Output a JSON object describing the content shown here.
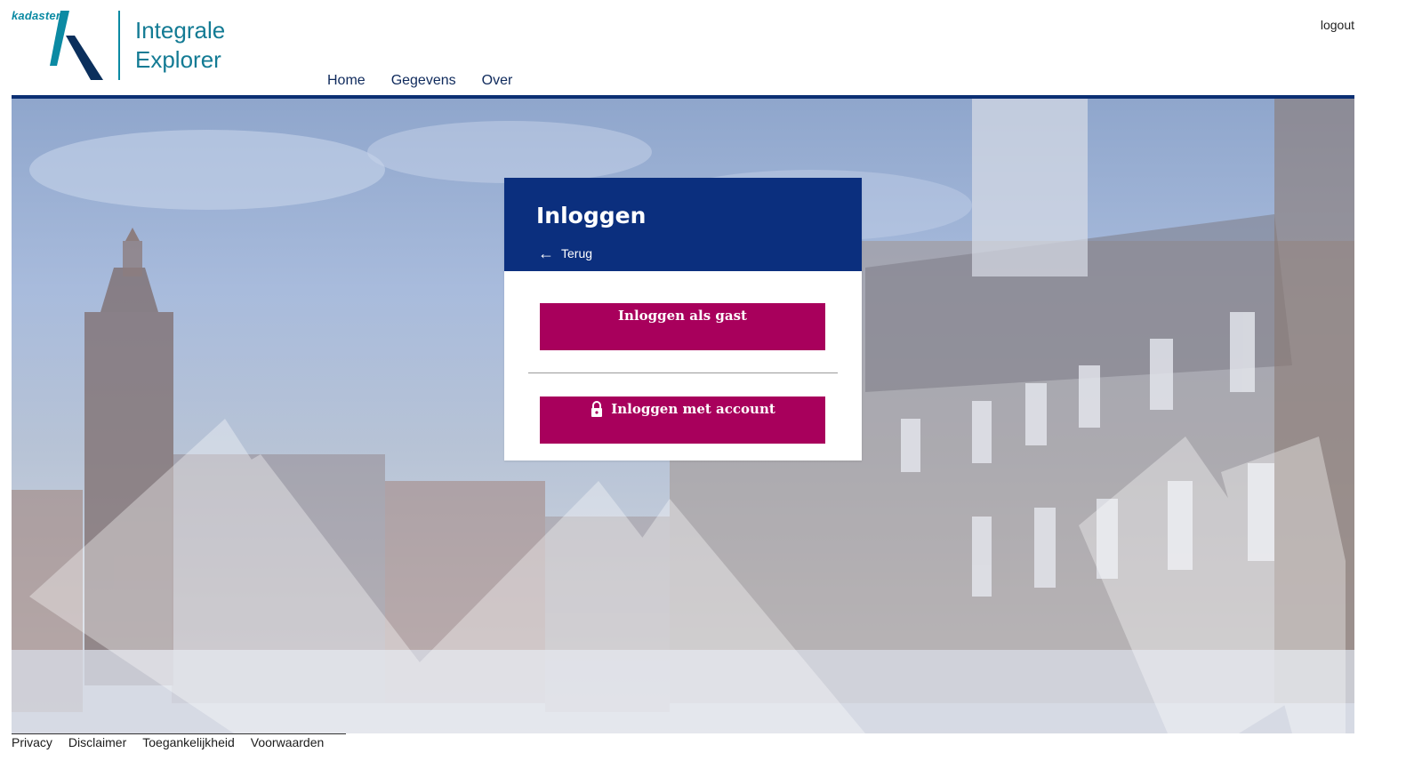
{
  "header": {
    "brand": "kadaster",
    "title_line1": "Integrale",
    "title_line2": "Explorer",
    "logout": "logout"
  },
  "nav": {
    "items": [
      "Home",
      "Gegevens",
      "Over"
    ]
  },
  "login": {
    "title": "Inloggen",
    "back": "Terug",
    "guest_button": "Inloggen als gast",
    "account_button": "Inloggen met account"
  },
  "footer": {
    "links": [
      "Privacy",
      "Disclaimer",
      "Toegankelijkheid",
      "Voorwaarden"
    ]
  },
  "colors": {
    "brand_blue": "#0b2f7e",
    "brand_teal": "#0b8aa3",
    "button_magenta": "#a8005c"
  },
  "icons": {
    "logo": "kadaster-logo-icon",
    "back": "arrow-left-icon",
    "lock": "lock-icon"
  }
}
